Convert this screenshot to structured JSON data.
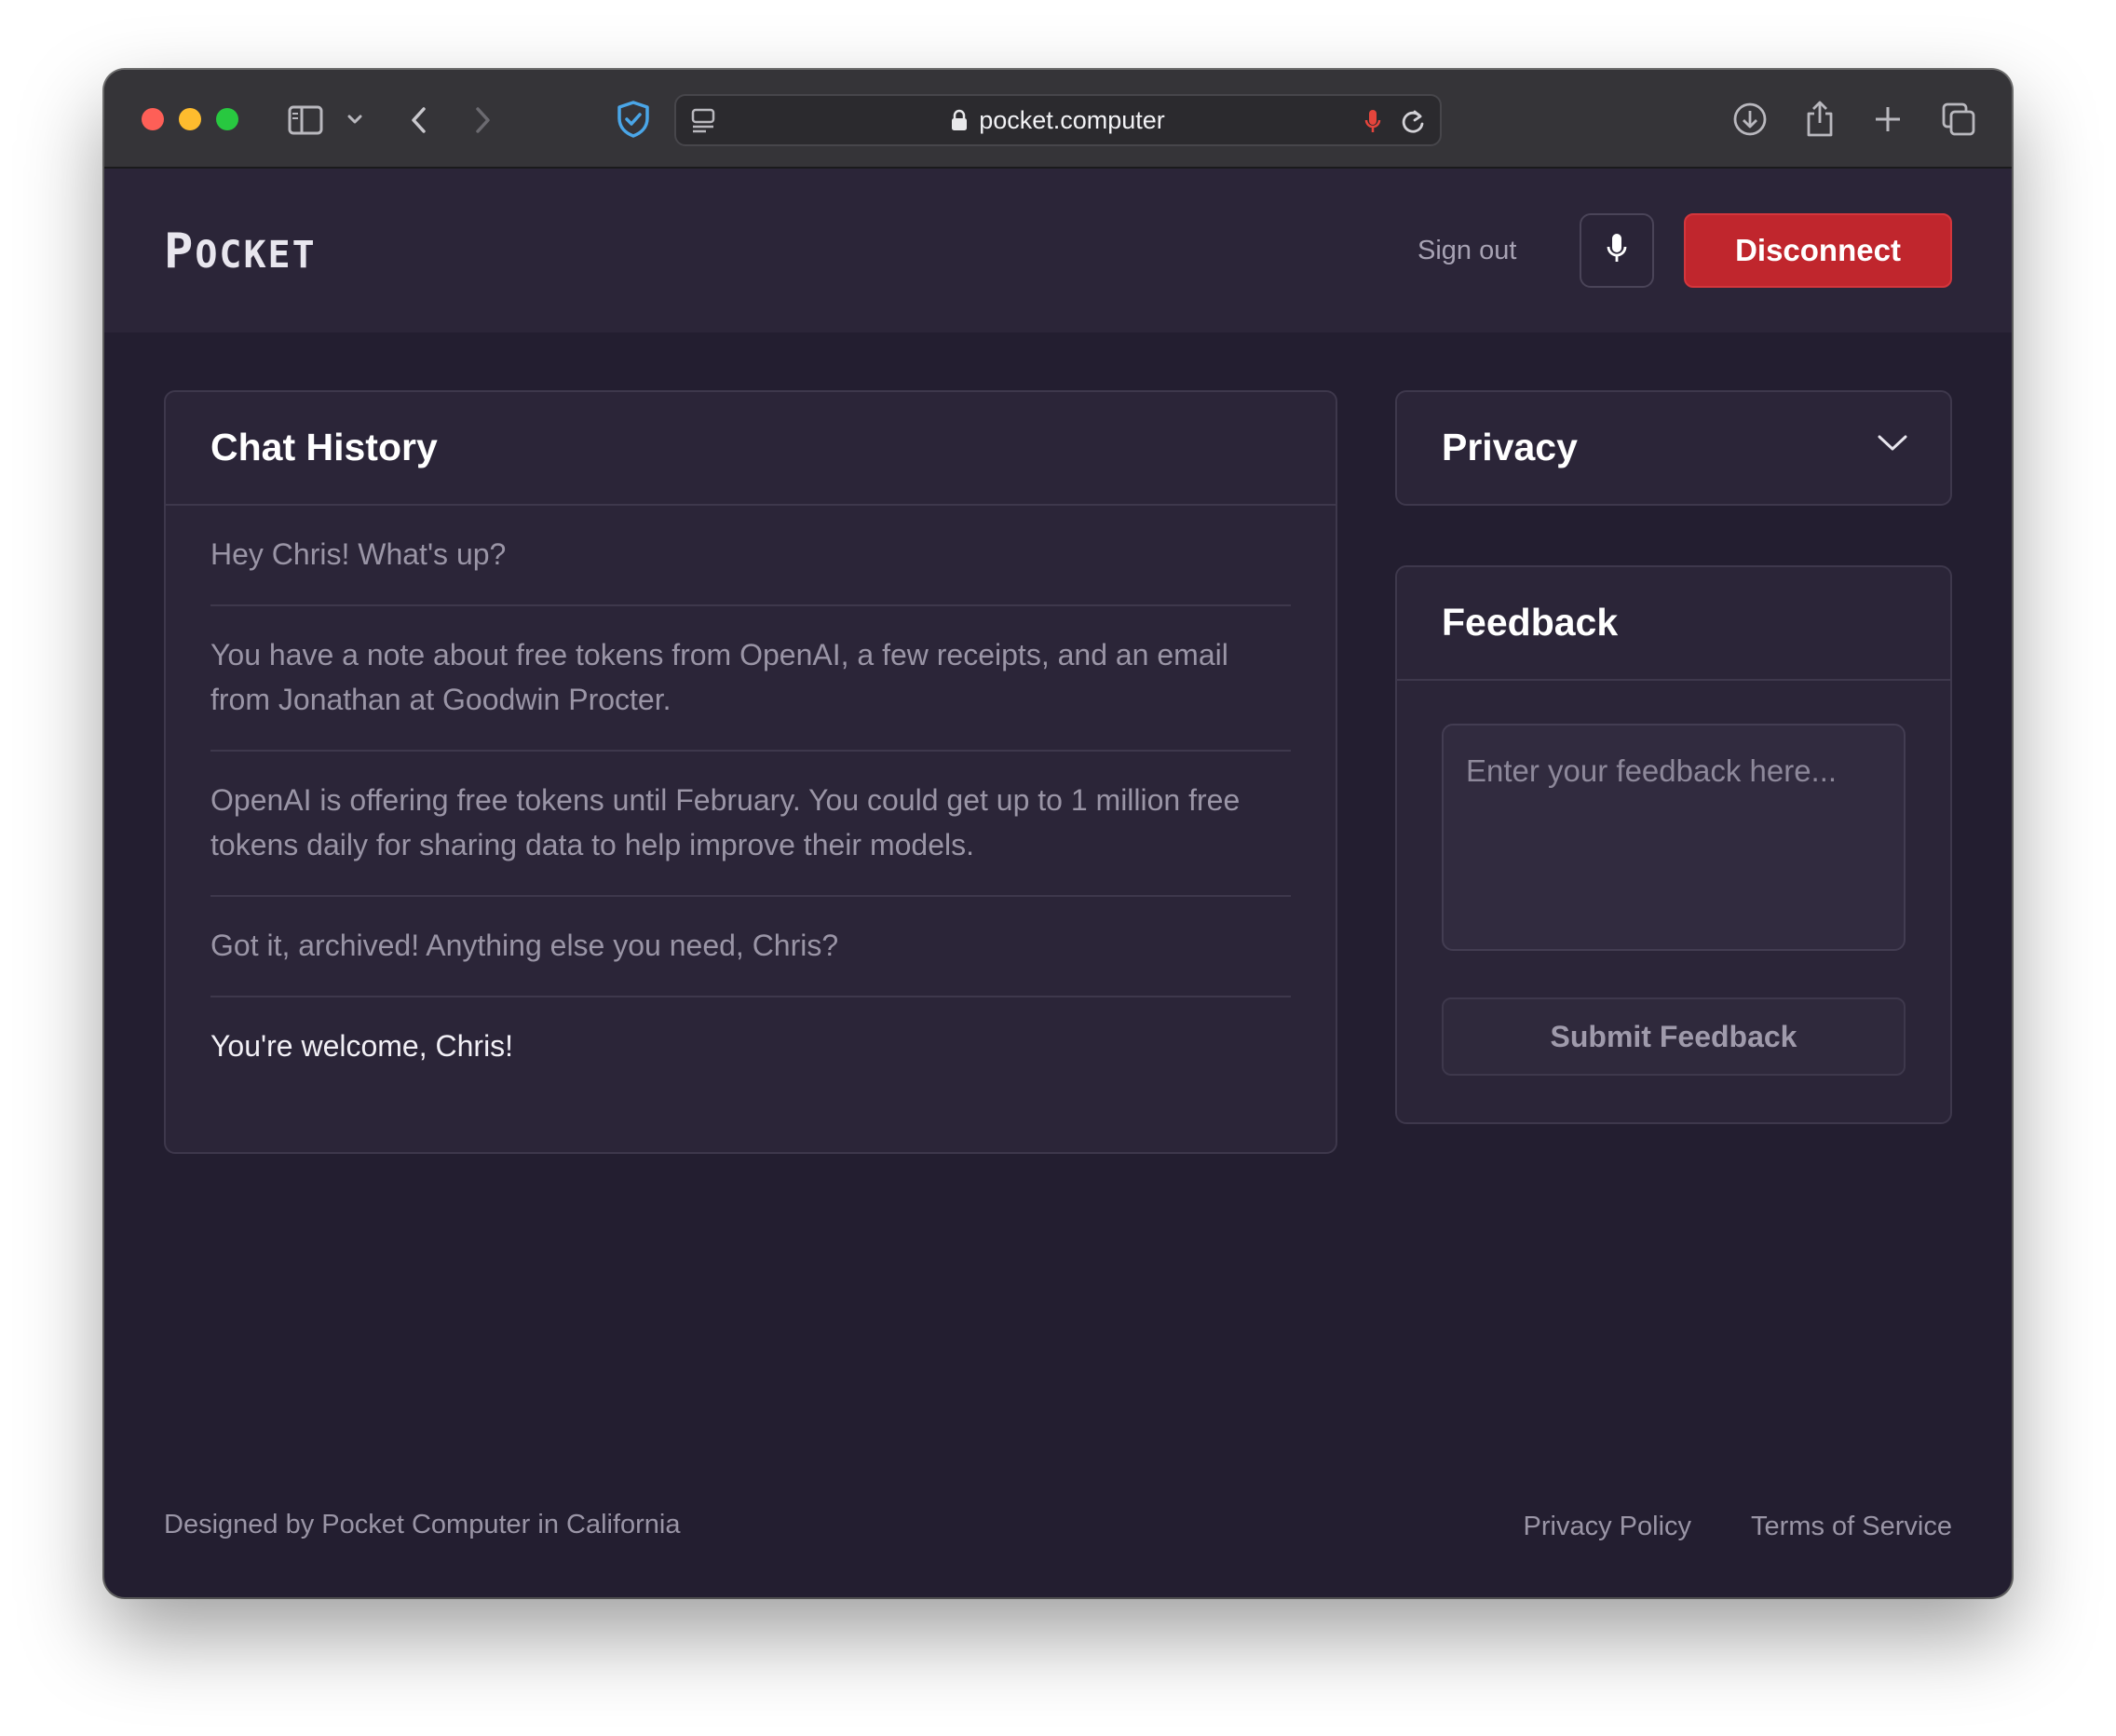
{
  "browser": {
    "url": "pocket.computer",
    "icons": [
      "sidebar-icon",
      "chevron-down-icon",
      "back-icon",
      "forward-icon",
      "shield-icon",
      "page-menu-icon",
      "lock-icon",
      "mic-icon",
      "reload-icon",
      "download-icon",
      "share-icon",
      "new-tab-icon",
      "tab-overview-icon"
    ],
    "accent_colors": {
      "shield": "#4aa6e8",
      "mic": "#e5453c"
    }
  },
  "header": {
    "logo": {
      "first": "P",
      "rest": "OCKET"
    },
    "sign_out": "Sign out",
    "disconnect": "Disconnect",
    "disconnect_color": "#c0262d"
  },
  "chat": {
    "title": "Chat History",
    "messages": [
      "Hey Chris! What's up?",
      "You have a note about free tokens from OpenAI, a few receipts, and an email from Jonathan at Goodwin Procter.",
      "OpenAI is offering free tokens until February. You could get up to 1 million free tokens daily for sharing data to help improve their models.",
      "Got it, archived! Anything else you need, Chris?",
      "You're welcome, Chris!"
    ]
  },
  "privacy": {
    "title": "Privacy"
  },
  "feedback": {
    "title": "Feedback",
    "placeholder": "Enter your feedback here...",
    "submit": "Submit Feedback"
  },
  "footer": {
    "credit": "Designed by Pocket Computer in California",
    "privacy_policy": "Privacy Policy",
    "terms": "Terms of Service"
  }
}
